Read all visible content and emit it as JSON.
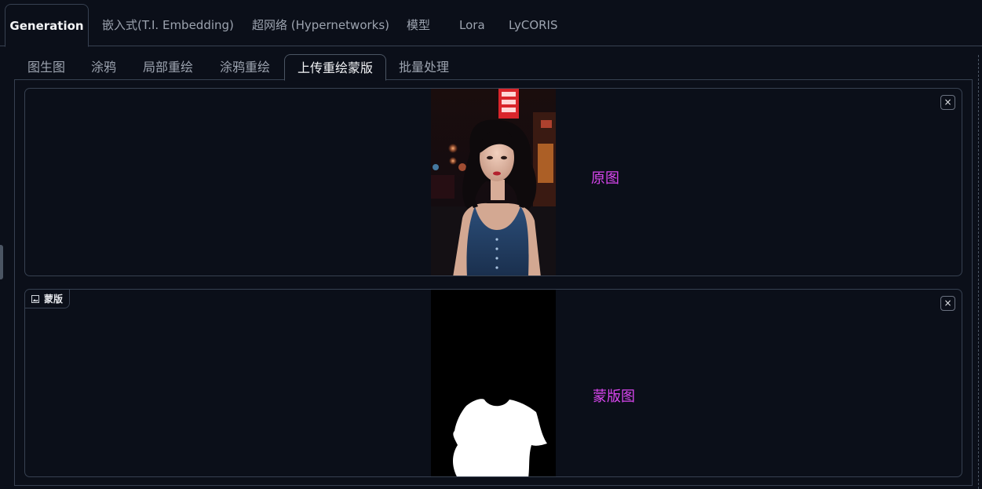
{
  "top_tabs": [
    {
      "label": "Generation",
      "active": true
    },
    {
      "label": "嵌入式(T.I. Embedding)",
      "active": false
    },
    {
      "label": "超网络 (Hypernetworks)",
      "active": false
    },
    {
      "label": "模型",
      "active": false
    },
    {
      "label": "Lora",
      "active": false
    },
    {
      "label": "LyCORIS",
      "active": false
    }
  ],
  "sub_tabs": [
    {
      "label": "图生图",
      "active": false
    },
    {
      "label": "涂鸦",
      "active": false
    },
    {
      "label": "局部重绘",
      "active": false
    },
    {
      "label": "涂鸦重绘",
      "active": false
    },
    {
      "label": "上传重绘蒙版",
      "active": true
    },
    {
      "label": "批量处理",
      "active": false
    }
  ],
  "original_box": {
    "close_label": "×",
    "annotation": "原图"
  },
  "mask_box": {
    "label": "蒙版",
    "close_label": "×",
    "annotation": "蒙版图"
  },
  "colors": {
    "background": "#0b0f19",
    "border": "#374151",
    "annotation": "#d946ef"
  },
  "icons": [
    "image-icon",
    "close-icon"
  ]
}
